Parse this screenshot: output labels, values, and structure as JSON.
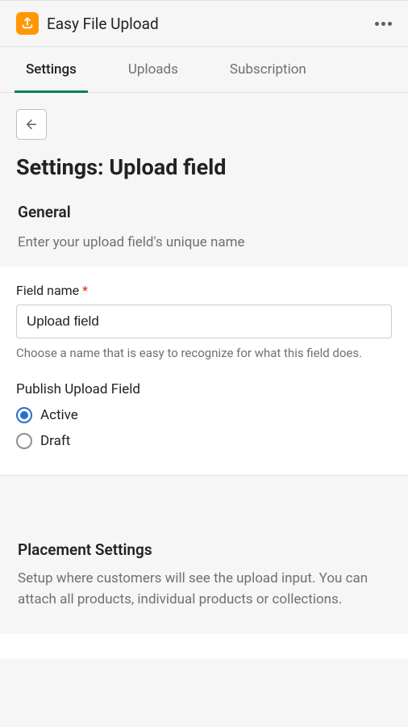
{
  "header": {
    "app_title": "Easy File Upload"
  },
  "tabs": {
    "settings": "Settings",
    "uploads": "Uploads",
    "subscription": "Subscription"
  },
  "page": {
    "title": "Settings: Upload field"
  },
  "general": {
    "title": "General",
    "subtitle": "Enter your upload field's unique name",
    "field_name_label": "Field name",
    "field_name_value": "Upload field",
    "field_name_help": "Choose a name that is easy to recognize for what this field does.",
    "publish_label": "Publish Upload Field",
    "option_active": "Active",
    "option_draft": "Draft"
  },
  "placement": {
    "title": "Placement Settings",
    "description": "Setup where customers will see the upload input. You can attach all products, individual products or collections."
  }
}
